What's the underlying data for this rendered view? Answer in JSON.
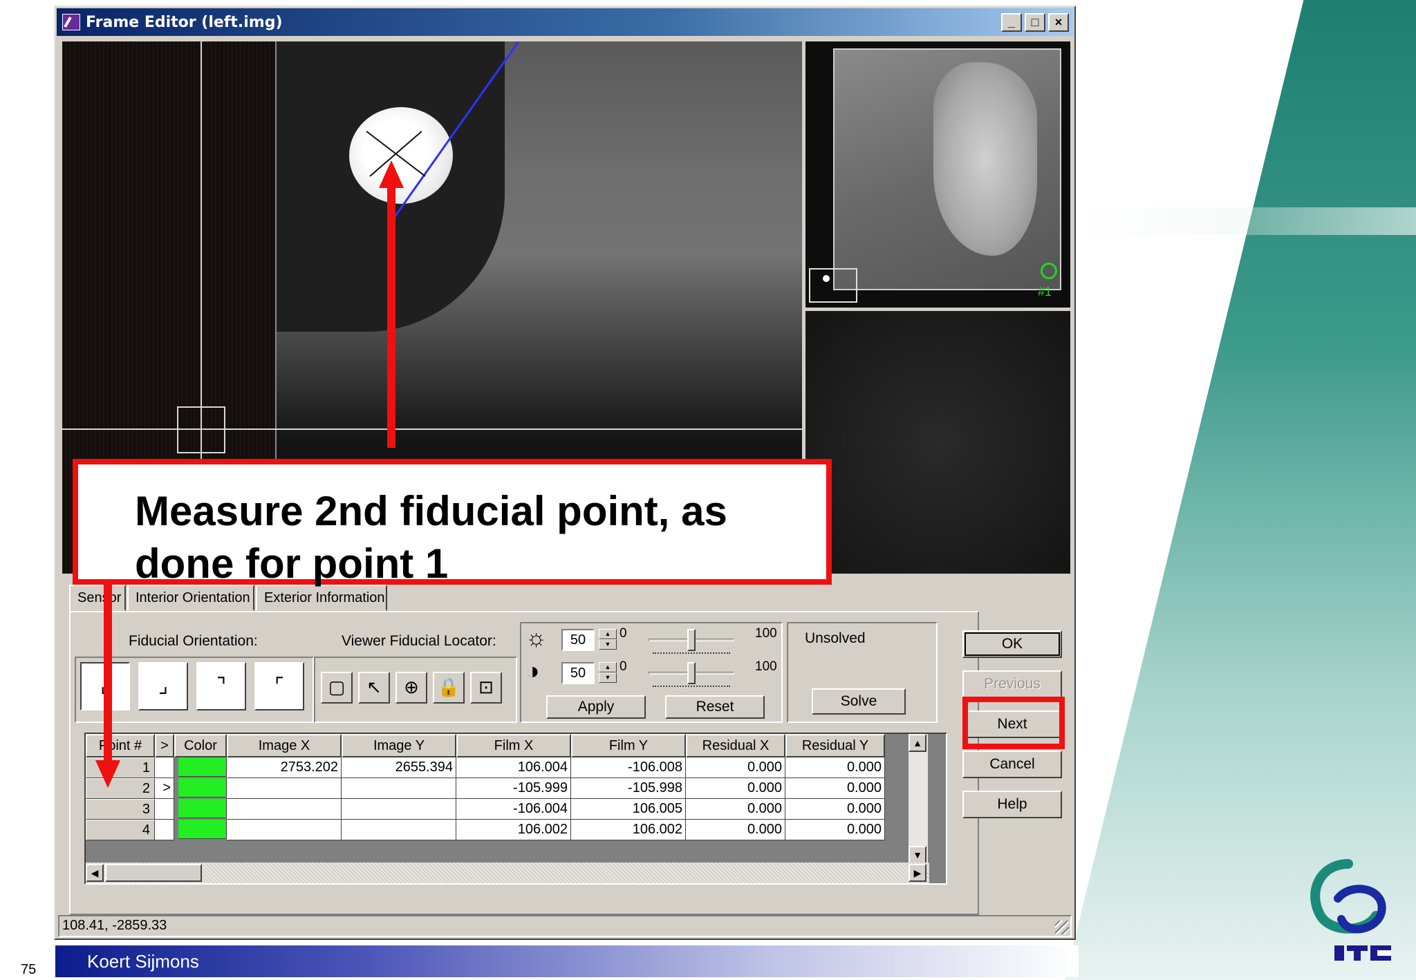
{
  "window": {
    "title": "Frame Editor (left.img)",
    "controls": {
      "minimize": "_",
      "maximize": "□",
      "close": "×"
    }
  },
  "overview": {
    "marker_label": "#1"
  },
  "tabs": [
    "Sensor",
    "Interior Orientation",
    "Exterior Information"
  ],
  "panel": {
    "fiducial_orientation_label": "Fiducial Orientation:",
    "viewer_locator_label": "Viewer Fiducial Locator:",
    "brightness": {
      "value": "50",
      "min": "0",
      "max": "100"
    },
    "contrast": {
      "value": "50",
      "min": "0",
      "max": "100"
    },
    "apply": "Apply",
    "reset": "Reset",
    "status": "Unsolved",
    "solve": "Solve"
  },
  "buttons": {
    "ok": "OK",
    "previous": "Previous",
    "next": "Next",
    "cancel": "Cancel",
    "help": "Help"
  },
  "grid": {
    "columns": [
      "Point #",
      ">",
      "Color",
      "Image X",
      "Image Y",
      "Film X",
      "Film Y",
      "Residual X",
      "Residual Y"
    ],
    "rows": [
      {
        "point": "1",
        "cur": "",
        "image_x": "2753.202",
        "image_y": "2655.394",
        "film_x": "106.004",
        "film_y": "-106.008",
        "res_x": "0.000",
        "res_y": "0.000"
      },
      {
        "point": "2",
        "cur": ">",
        "image_x": "",
        "image_y": "",
        "film_x": "-105.999",
        "film_y": "-105.998",
        "res_x": "0.000",
        "res_y": "0.000"
      },
      {
        "point": "3",
        "cur": "",
        "image_x": "",
        "image_y": "",
        "film_x": "-106.004",
        "film_y": "106.005",
        "res_x": "0.000",
        "res_y": "0.000"
      },
      {
        "point": "4",
        "cur": "",
        "image_x": "",
        "image_y": "",
        "film_x": "106.002",
        "film_y": "106.002",
        "res_x": "0.000",
        "res_y": "0.000"
      }
    ],
    "point_color": "#22ee22"
  },
  "statusbar": {
    "coords": "108.41, -2859.33"
  },
  "callout": {
    "text": "Measure 2nd fiducial point, as done for point 1"
  },
  "footer": {
    "author": "Koert Sijmons",
    "page": "75"
  },
  "icons": {
    "brightness": "sun-icon",
    "contrast": "contrast-icon",
    "locator": [
      "frame-icon",
      "arrow-pointer-icon",
      "crosshair-icon",
      "lock-icon",
      "zoom-fit-icon"
    ]
  },
  "colors": {
    "accent_red": "#f01010",
    "title_blue": "#0a246a",
    "footer_blue": "#0c1e8c"
  }
}
